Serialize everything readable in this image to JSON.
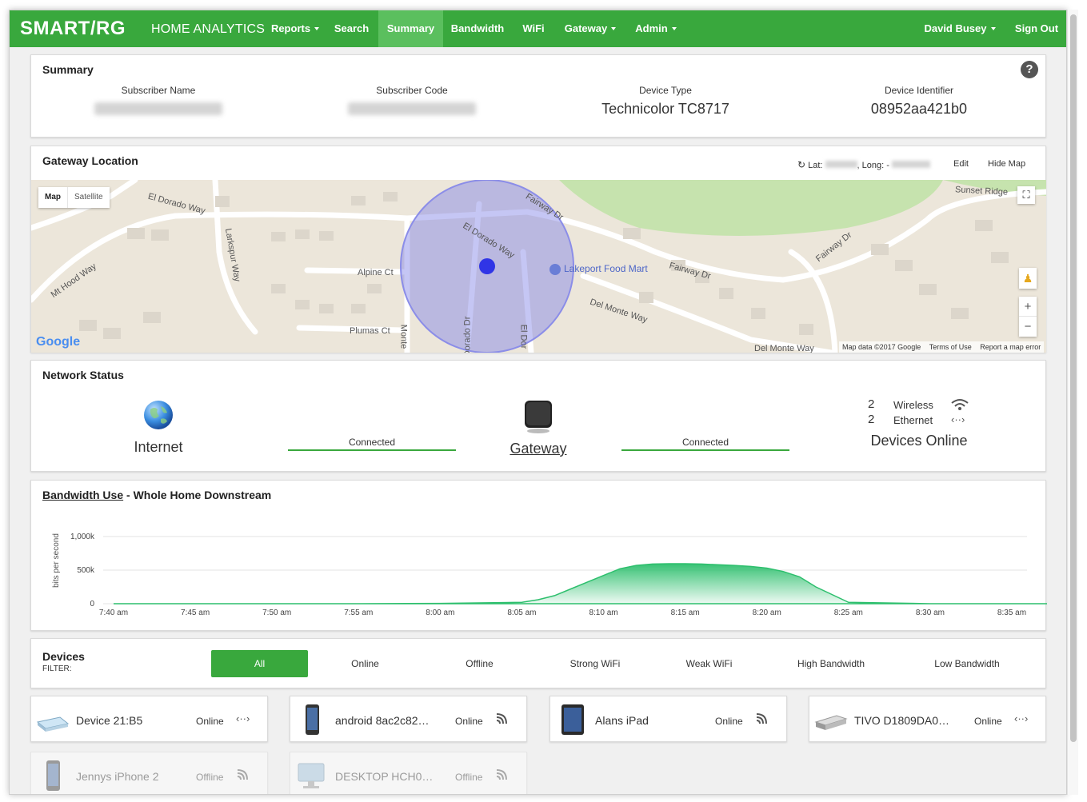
{
  "nav": {
    "logo": "SMART/RG",
    "app_title": "HOME ANALYTICS",
    "items": [
      {
        "label": "Reports",
        "dropdown": true,
        "active": false
      },
      {
        "label": "Search",
        "dropdown": false,
        "active": false
      },
      {
        "label": "Summary",
        "dropdown": false,
        "active": true
      },
      {
        "label": "Bandwidth",
        "dropdown": false,
        "active": false
      },
      {
        "label": "WiFi",
        "dropdown": false,
        "active": false
      },
      {
        "label": "Gateway",
        "dropdown": true,
        "active": false
      },
      {
        "label": "Admin",
        "dropdown": true,
        "active": false
      }
    ],
    "user": "David Busey",
    "signout": "Sign Out",
    "color": "#39a83d"
  },
  "summary": {
    "title": "Summary",
    "help_icon": "question-circle-icon",
    "subscriber_name_label": "Subscriber Name",
    "subscriber_code_label": "Subscriber Code",
    "device_type_label": "Device Type",
    "device_type": "Technicolor TC8717",
    "device_id_label": "Device Identifier",
    "device_id": "08952aa421b0"
  },
  "location": {
    "title": "Gateway Location",
    "lat_label": "Lat:",
    "long_label": ", Long: -",
    "edit": "Edit",
    "hide_map": "Hide Map",
    "map_btn": "Map",
    "satellite_btn": "Satellite",
    "streets": [
      "El Dorado Way",
      "Larkspur Way",
      "Alpine Ct",
      "Mt Hood Way",
      "Plumas Ct",
      "Monte",
      "El Dorado Way",
      "Fairway Dr",
      "Fairway Dr",
      "Fairway Dr",
      "Del Monte Way",
      "Del Monte Way",
      "Sunset Ridge",
      "El Dor",
      "Dorado Dr"
    ],
    "poi": "Lakeport Food Mart",
    "google": "Google",
    "map_data": "Map data ©2017 Google",
    "terms": "Terms of Use",
    "report": "Report a map error",
    "zoom_in": "+",
    "zoom_out": "−"
  },
  "network": {
    "title": "Network Status",
    "internet": "Internet",
    "gateway": "Gateway",
    "connected_1": "Connected",
    "connected_2": "Connected",
    "wireless_count": "2",
    "wireless_label": "Wireless",
    "ethernet_count": "2",
    "ethernet_label": "Ethernet",
    "devices_online": "Devices Online"
  },
  "bandwidth": {
    "title_link": "Bandwidth Use",
    "title_rest": " - Whole Home Downstream"
  },
  "chart_data": {
    "type": "area",
    "title": "",
    "xlabel": "",
    "ylabel": "bits per second",
    "y_ticks": [
      "0",
      "500k",
      "1,000k"
    ],
    "ylim": [
      0,
      1000000
    ],
    "x_ticks": [
      "7:40 am",
      "7:45 am",
      "7:50 am",
      "7:55 am",
      "8:00 am",
      "8:05 am",
      "8:10 am",
      "8:15 am",
      "8:20 am",
      "8:25 am",
      "8:30 am",
      "8:35 am"
    ],
    "x_minutes": [
      0,
      5,
      10,
      15,
      20,
      25,
      26,
      27,
      28,
      29,
      30,
      31,
      32,
      33,
      34,
      35,
      36,
      37,
      38,
      39,
      40,
      41,
      42,
      43,
      45,
      50,
      55,
      60,
      65
    ],
    "values": [
      0,
      0,
      0,
      0,
      5000,
      20000,
      60000,
      120000,
      220000,
      320000,
      420000,
      520000,
      570000,
      590000,
      595000,
      595000,
      590000,
      580000,
      570000,
      555000,
      530000,
      480000,
      400000,
      250000,
      20000,
      0,
      0,
      0,
      0
    ],
    "grid": true,
    "color": "#2dbf6d"
  },
  "devices": {
    "title": "Devices",
    "filter_label": "FILTER:",
    "filters": [
      "All",
      "Online",
      "Offline",
      "Strong WiFi",
      "Weak WiFi",
      "High Bandwidth",
      "Low Bandwidth"
    ],
    "active_filter": "All",
    "list": [
      {
        "name": "Device 21:B5",
        "status": "Online",
        "conn": "ethernet-icon",
        "img": "router-device-icon",
        "online": true
      },
      {
        "name": "android 8ac2c82…",
        "status": "Online",
        "conn": "wifi-signal-icon",
        "img": "phone-device-icon",
        "online": true
      },
      {
        "name": "Alans iPad",
        "status": "Online",
        "conn": "wifi-signal-icon",
        "img": "tablet-device-icon",
        "online": true
      },
      {
        "name": "TIVO D1809DA0…",
        "status": "Online",
        "conn": "ethernet-icon",
        "img": "tivo-device-icon",
        "online": true
      },
      {
        "name": "Jennys iPhone 2",
        "status": "Offline",
        "conn": "wifi-signal-icon",
        "img": "phone-device-icon",
        "online": false
      },
      {
        "name": "DESKTOP HCH0…",
        "status": "Offline",
        "conn": "wifi-signal-icon",
        "img": "desktop-device-icon",
        "online": false
      }
    ]
  }
}
